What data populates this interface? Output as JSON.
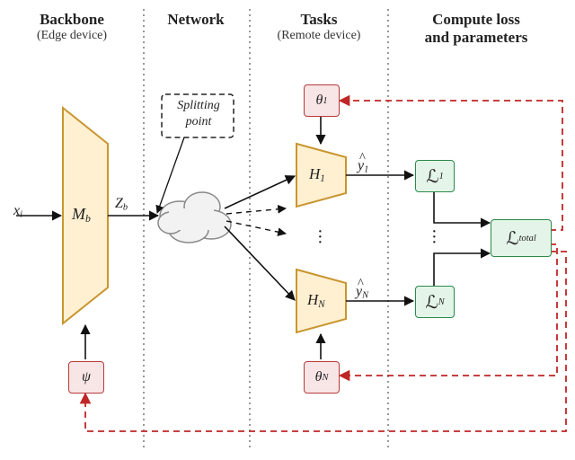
{
  "headers": {
    "backbone": "Backbone",
    "backbone_sub": "(Edge device)",
    "network": "Network",
    "tasks": "Tasks",
    "tasks_sub": "(Remote device)",
    "loss": "Compute loss\nand parameters"
  },
  "labels": {
    "xi": "x",
    "xi_sub": "i",
    "Mb": "M",
    "Mb_sub": "b",
    "Zb": "Z",
    "Zb_sub": "b",
    "splitting": "Splitting\npoint",
    "psi": "ψ",
    "theta1": "θ",
    "theta1_sub": "1",
    "thetaN": "θ",
    "thetaN_sub": "N",
    "H1": "H",
    "H1_sub": "1",
    "HN": "H",
    "HN_sub": "N",
    "yhat1": "y",
    "yhat1_sub": "1",
    "yhatN": "y",
    "yhatN_sub": "N",
    "L1_sub": "1",
    "LN_sub": "N",
    "Ltotal_sub": "total"
  },
  "script_L": "ℒ",
  "chart_data": {
    "type": "diagram",
    "columns": [
      {
        "title": "Backbone",
        "subtitle": "Edge device"
      },
      {
        "title": "Network"
      },
      {
        "title": "Tasks",
        "subtitle": "Remote device"
      },
      {
        "title": "Compute loss and parameters"
      }
    ],
    "forward_flow": [
      "x_i -> M_b -> Z_b -> (splitting point / network cloud) -> H_1 -> y_hat_1 -> L_1",
      "x_i -> M_b -> Z_b -> (splitting point / network cloud) -> H_N -> y_hat_N -> L_N",
      "L_1 + ... + L_N -> L_total"
    ],
    "parameter_updates_dashed_red": [
      "L_total -> theta_1 -> H_1",
      "L_total -> theta_N -> H_N",
      "L_total -> psi -> M_b"
    ],
    "nodes": {
      "M_b": {
        "type": "backbone_trapezoid",
        "params": "psi"
      },
      "cloud": {
        "type": "network_cloud",
        "note": "splitting point"
      },
      "H_1": {
        "type": "task_head",
        "params": "theta_1",
        "output": "y_hat_1"
      },
      "H_N": {
        "type": "task_head",
        "params": "theta_N",
        "output": "y_hat_N"
      },
      "L_1": {
        "type": "loss"
      },
      "L_N": {
        "type": "loss"
      },
      "L_total": {
        "type": "total_loss"
      }
    }
  }
}
